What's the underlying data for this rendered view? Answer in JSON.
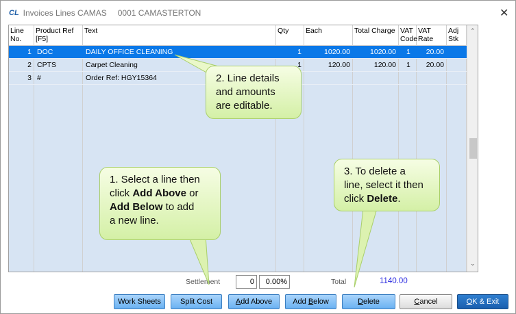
{
  "window": {
    "logo": "CL",
    "title": "Invoices Lines CAMAS",
    "subtitle": "0001 CAMASTERTON",
    "close_icon": "close-icon"
  },
  "grid": {
    "headers": [
      [
        "Line",
        "No."
      ],
      [
        "Product Ref",
        "[F5]"
      ],
      [
        "Text",
        ""
      ],
      [
        "Qty",
        ""
      ],
      [
        "Each",
        ""
      ],
      [
        "Total Charge",
        ""
      ],
      [
        "VAT",
        "Code"
      ],
      [
        "VAT",
        "Rate"
      ],
      [
        "Adj",
        "Stk"
      ]
    ],
    "rows": [
      {
        "line": "1",
        "ref": "DOC",
        "text": "DAILY OFFICE CLEANING",
        "qty": "1",
        "each": "1020.00",
        "total": "1020.00",
        "vat_code": "1",
        "vat_rate": "20.00",
        "selected": true
      },
      {
        "line": "2",
        "ref": "CPTS",
        "text": "Carpet Cleaning",
        "qty": "1",
        "each": "120.00",
        "total": "120.00",
        "vat_code": "1",
        "vat_rate": "20.00"
      },
      {
        "line": "3",
        "ref": "#",
        "text": "Order Ref: HGY15364",
        "qty": "",
        "each": "",
        "total": "",
        "vat_code": "",
        "vat_rate": ""
      }
    ],
    "selection_color": "#0a78e8"
  },
  "footer": {
    "settlement_label": "Settlement",
    "settlement_days": "0",
    "settlement_pct": "0.00%",
    "total_label": "Total",
    "total_value": "1140.00"
  },
  "buttons": {
    "work_sheets": "Work Sheets",
    "split_cost": "Split Cost",
    "add_above": {
      "u": "A",
      "rest": "dd Above"
    },
    "add_below": {
      "pre": "Add ",
      "u": "B",
      "rest": "elow"
    },
    "delete": {
      "u": "D",
      "rest": "elete"
    },
    "cancel": {
      "u": "C",
      "rest": "ancel"
    },
    "ok": {
      "u": "O",
      "rest": "K & Exit"
    }
  },
  "callouts": {
    "c1": {
      "l1": "1. Select a line then",
      "l2a": "click ",
      "l2b": "Add Above",
      "l2c": " or",
      "l3a": "Add Below",
      "l3b": " to add",
      "l4": "a new line."
    },
    "c2": {
      "l1": "2. Line details",
      "l2": "and amounts",
      "l3": "are editable."
    },
    "c3": {
      "l1": "3. To delete a",
      "l2": "line, select it then",
      "l3a": "click ",
      "l3b": "Delete",
      "l3c": "."
    }
  }
}
